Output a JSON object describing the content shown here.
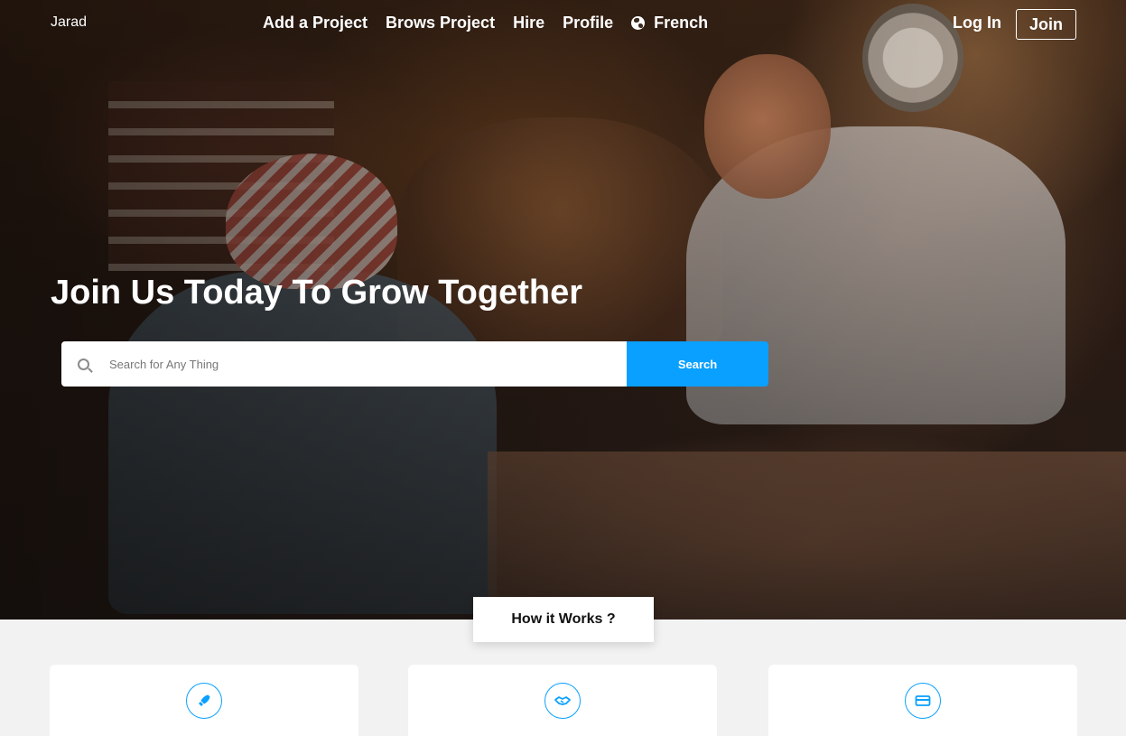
{
  "header": {
    "brand": "Jarad",
    "nav": [
      {
        "label": "Add a Project"
      },
      {
        "label": "Brows Project"
      },
      {
        "label": "Hire"
      },
      {
        "label": "Profile"
      }
    ],
    "language": {
      "label": "French",
      "icon": "globe-icon"
    },
    "login_label": "Log In",
    "join_label": "Join"
  },
  "hero": {
    "headline": "Join Us Today To Grow Together",
    "search": {
      "placeholder": "Search for Any Thing",
      "value": "",
      "button_label": "Search",
      "icon": "search-icon"
    }
  },
  "how_it_works": {
    "title": "How it Works ?",
    "cards": [
      {
        "icon": "rocket-icon"
      },
      {
        "icon": "handshake-icon"
      },
      {
        "icon": "credit-card-icon"
      }
    ]
  },
  "colors": {
    "accent": "#0aa0ff",
    "background": "#f2f2f2",
    "text_light": "#ffffff"
  }
}
